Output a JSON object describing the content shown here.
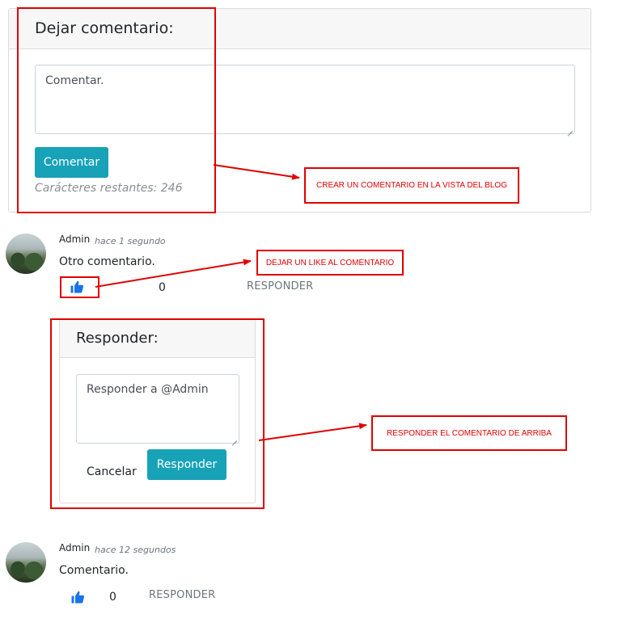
{
  "comment_form": {
    "title": "Dejar comentario:",
    "placeholder": "Comentar.",
    "submit_label": "Comentar",
    "counter": "Carácteres restantes: 246"
  },
  "comments": [
    {
      "author": "Admin",
      "time": "hace 1 segundo",
      "text": "Otro comentario.",
      "likes": "0",
      "reply_label": "RESPONDER"
    },
    {
      "author": "Admin",
      "time": "hace 12 segundos",
      "text": "Comentario.",
      "likes": "0",
      "reply_label": "RESPONDER"
    }
  ],
  "reply_form": {
    "title": "Responder:",
    "placeholder": "Responder a @Admin",
    "cancel_label": "Cancelar",
    "submit_label": "Responder"
  },
  "annotations": {
    "create_comment": "CREAR UN COMENTARIO EN LA VISTA DEL BLOG",
    "like_comment": "DEJAR UN LIKE AL COMENTARIO",
    "reply_comment": "RESPONDER EL COMENTARIO DE ARRIBA"
  },
  "colors": {
    "accent": "#17a2b8",
    "like_blue": "#1a73e8",
    "annotation_red": "#e00000"
  },
  "icons": {
    "like": "thumbs-up-icon",
    "avatar": "landscape-avatar"
  }
}
